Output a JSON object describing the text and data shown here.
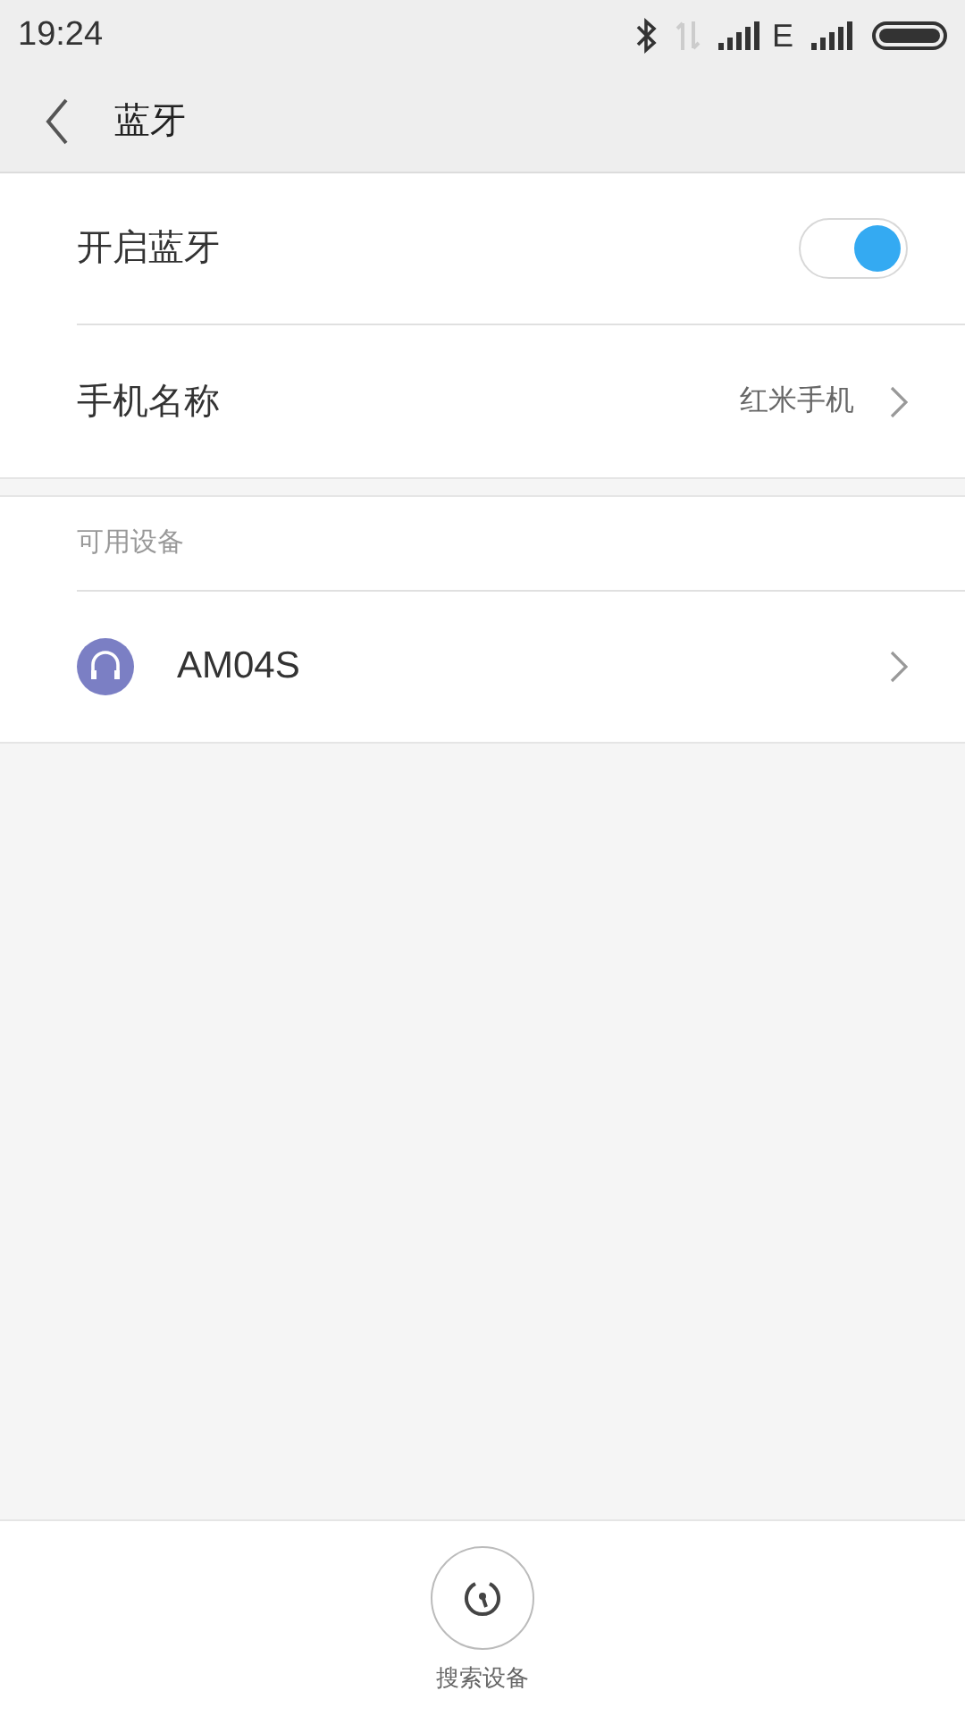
{
  "status_bar": {
    "time": "19:24",
    "network": "E"
  },
  "header": {
    "title": "蓝牙"
  },
  "settings": [
    {
      "kind": "toggle",
      "label": "开启蓝牙",
      "on": true
    },
    {
      "kind": "link",
      "label": "手机名称",
      "value": "红米手机"
    }
  ],
  "available_devices": {
    "heading": "可用设备",
    "devices": [
      {
        "name": "AM04S"
      }
    ]
  },
  "bottom_bar": {
    "search_label": "搜索设备"
  }
}
